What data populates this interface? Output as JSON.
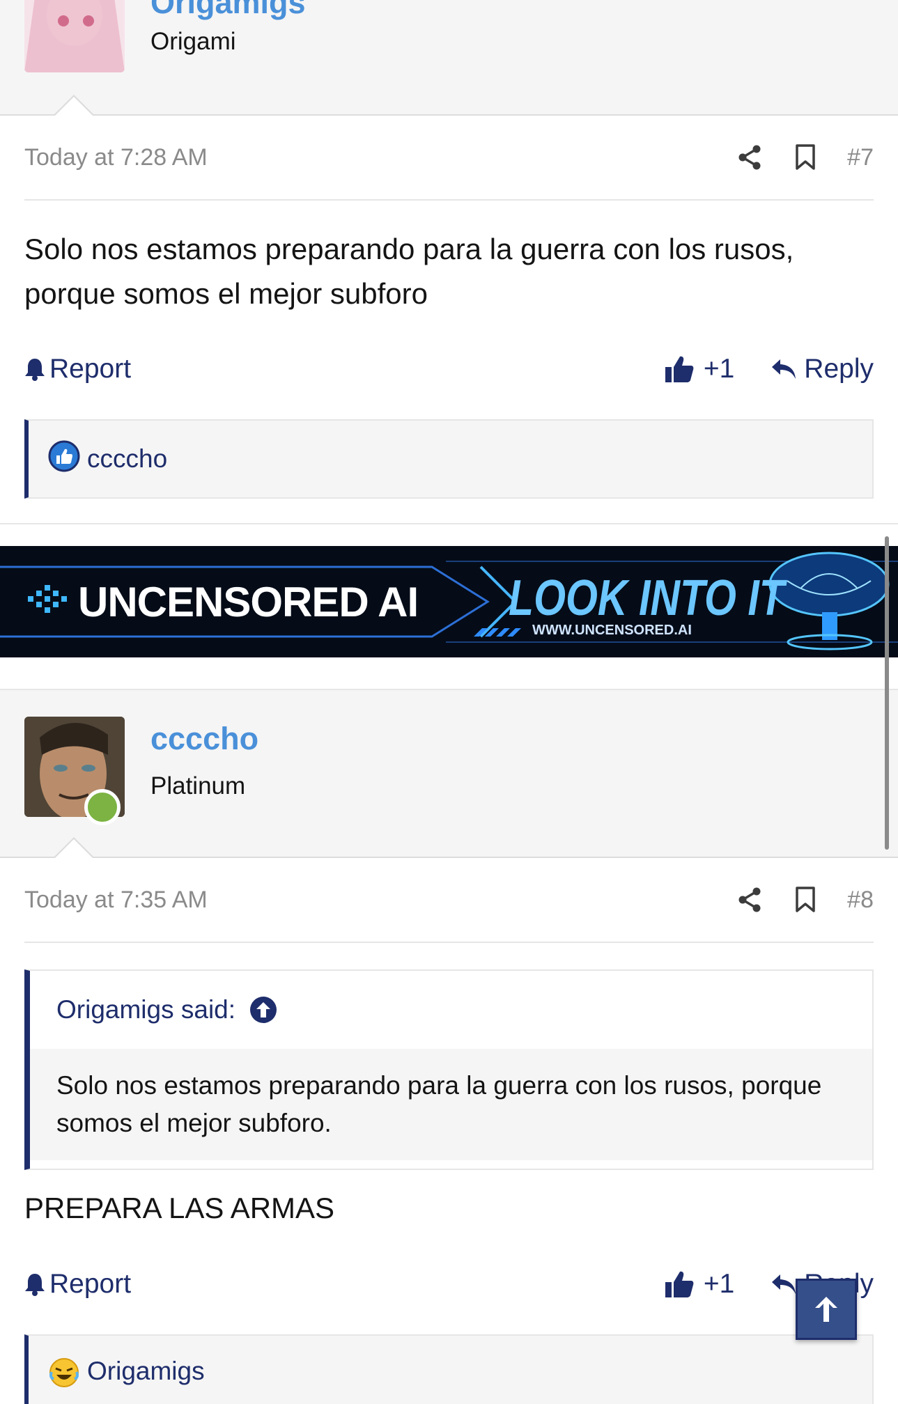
{
  "post7_header": {
    "username": "Origamigs",
    "title": "Origami"
  },
  "post7": {
    "time": "Today at 7:28 AM",
    "number": "#7",
    "body": "Solo nos estamos preparando para la guerra con los rusos, porque somos el mejor subforo",
    "report_label": "Report",
    "like_label": "+1",
    "reply_label": "Reply",
    "reactions_user": "ccccho"
  },
  "ad": {
    "left_text": "UNCENSORED AI",
    "right_text": "LOOK INTO IT",
    "url": "WWW.UNCENSORED.AI"
  },
  "post8_header": {
    "username": "ccccho",
    "title": "Platinum"
  },
  "post8": {
    "time": "Today at 7:35 AM",
    "number": "#8",
    "quote_author": "Origamigs said:",
    "quote_text": "Solo nos estamos preparando para la guerra con los rusos, porque somos el mejor subforo.",
    "body": "PREPARA LAS ARMAS",
    "report_label": "Report",
    "like_label": "+1",
    "reply_label": "Reply",
    "reactions_user": "Origamigs"
  },
  "colors": {
    "accent": "#1e2d6b",
    "username": "#4a90d9",
    "online": "#7cb342"
  }
}
